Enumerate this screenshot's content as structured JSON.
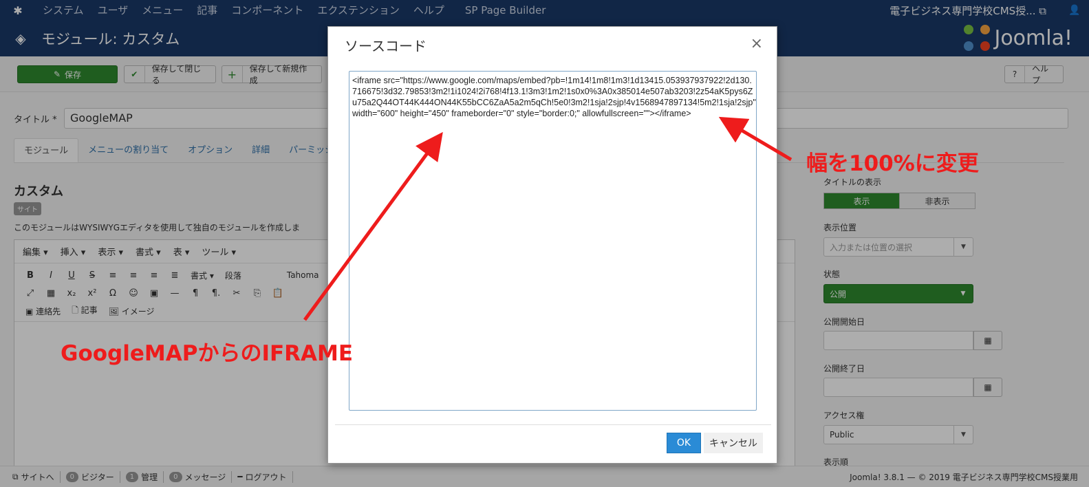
{
  "topnav": {
    "menu": [
      "システム",
      "ユーザ",
      "メニュー",
      "記事",
      "コンポーネント",
      "エクステンション",
      "ヘルプ",
      "SP Page Builder"
    ],
    "site_name": "電子ビジネス専門学校CMS授...",
    "external_icon": "external-link-icon",
    "user_icon": "user-icon"
  },
  "header": {
    "title": "モジュール: カスタム",
    "brand": "Joomla!"
  },
  "toolbar": {
    "save": "保存",
    "save_close": "保存して閉じる",
    "save_new": "保存して新規作成",
    "help": "ヘルプ"
  },
  "form": {
    "title_label": "タイトル *",
    "title_value": "GoogleMAP",
    "tabs": [
      "モジュール",
      "メニューの割り当て",
      "オプション",
      "詳細",
      "パーミッシ"
    ],
    "heading": "カスタム",
    "badge": "サイト",
    "description": "このモジュールはWYSIWYGエディタを使用して独自のモジュールを作成しま"
  },
  "editor": {
    "menus": [
      "編集 ▾",
      "挿入 ▾",
      "表示 ▾",
      "書式 ▾",
      "表 ▾",
      "ツール ▾"
    ],
    "format_label": "書式 ▾",
    "paragraph_label": "段落",
    "font_label": "Tahoma",
    "contact_label": "連絡先",
    "article_label": "記事",
    "image_label": "イメージ"
  },
  "sidebar": {
    "show_title_label": "タイトルの表示",
    "show_on": "表示",
    "show_off": "非表示",
    "position_label": "表示位置",
    "position_placeholder": "入力または位置の選択",
    "status_label": "状態",
    "status_value": "公開",
    "publish_start_label": "公開開始日",
    "publish_end_label": "公開終了日",
    "access_label": "アクセス権",
    "access_value": "Public",
    "order_label": "表示順"
  },
  "statusbar": {
    "site": "サイトへ",
    "visitors_count": "0",
    "visitors": "ビジター",
    "admin_count": "1",
    "admin": "管理",
    "messages_count": "0",
    "messages": "メッセージ",
    "logout": "ログアウト",
    "copyright": "Joomla! 3.8.1 — © 2019 電子ビジネス専門学校CMS授業用"
  },
  "modal": {
    "title": "ソースコード",
    "close": "×",
    "code": "<iframe src=\"https://www.google.com/maps/embed?pb=!1m14!1m8!1m3!1d13415.053937937922!2d130.716675!3d32.79853!3m2!1i1024!2i768!4f13.1!3m3!1m2!1s0x0%3A0x385014e507ab3203!2z54aK5pys6Zu75a2Q44OT44K444ON44K55bCC6ZaA5a2m5qCh!5e0!3m2!1sja!2sjp!4v1568947897134!5m2!1sja!2sjp\" width=\"600\" height=\"450\" frameborder=\"0\" style=\"border:0;\" allowfullscreen=\"\"></iframe>",
    "ok": "OK",
    "cancel": "キャンセル"
  },
  "annotations": {
    "left": "GoogleMAPからのIFRAME",
    "right": "幅を100%に変更"
  },
  "colors": {
    "nav": "#1a3867",
    "green": "#2f8a2f",
    "primary": "#2a8bd6",
    "annotation": "#ee1c1c"
  }
}
